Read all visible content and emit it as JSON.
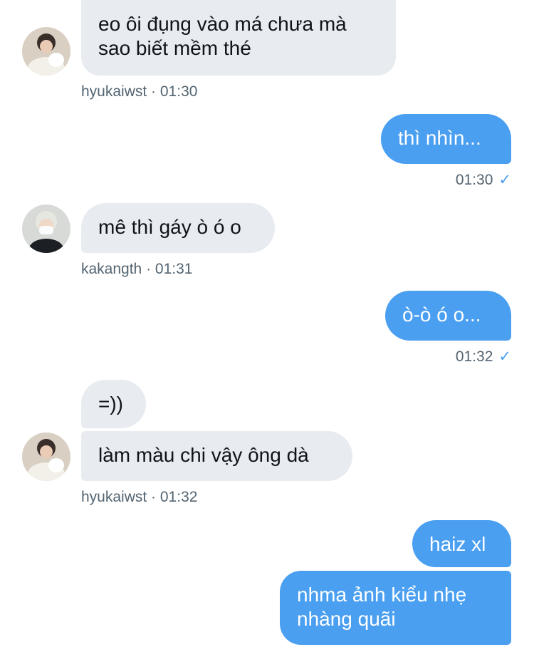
{
  "messages": [
    {
      "text": "eo ôi đụng vào má chưa mà sao biết mềm thé",
      "direction": "incoming"
    },
    {
      "meta": {
        "user": "hyukaiwst",
        "time": "01:30"
      }
    },
    {
      "text": "thì nhìn...",
      "direction": "outgoing"
    },
    {
      "meta": {
        "time": "01:30",
        "status": "✓"
      }
    },
    {
      "text": "mê thì gáy ò ó o",
      "direction": "incoming"
    },
    {
      "meta": {
        "user": "kakangth",
        "time": "01:31"
      }
    },
    {
      "text": "ò-ò ó o...",
      "direction": "outgoing"
    },
    {
      "meta": {
        "time": "01:32",
        "status": "✓"
      }
    },
    {
      "text": "=))",
      "direction": "incoming"
    },
    {
      "text": "làm màu chi vậy ông dà",
      "direction": "incoming"
    },
    {
      "meta": {
        "user": "hyukaiwst",
        "time": "01:32"
      }
    },
    {
      "text": "haiz xl",
      "direction": "outgoing"
    },
    {
      "text": "nhma ảnh kiểu nhẹ nhàng quãi",
      "direction": "outgoing"
    }
  ],
  "separator": " · ",
  "colors": {
    "incoming_bubble": "#e8ebf0",
    "outgoing_bubble": "#4a9ff0",
    "meta_text": "#536471",
    "read_check": "#4a9ff0"
  },
  "icons": {
    "avatar_1": "avatar-hyukaiwst",
    "avatar_2": "avatar-kakangth",
    "read_status": "checkmark-icon"
  }
}
